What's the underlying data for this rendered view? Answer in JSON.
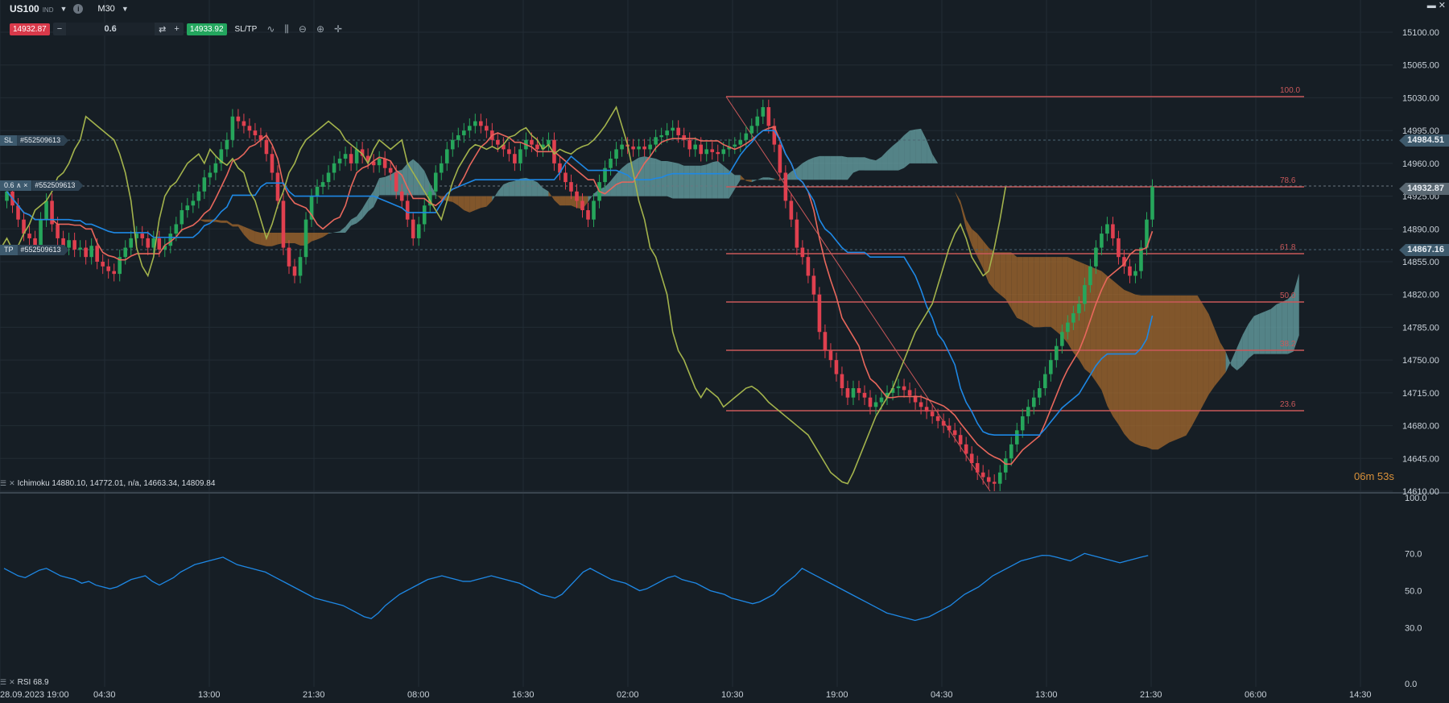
{
  "header": {
    "symbol": "US100",
    "symbol_suffix": "IND",
    "timeframe": "M30",
    "sell_price": "14932.87",
    "quantity": "0.6",
    "buy_price": "14933.92",
    "sltp_label": "SL/TP",
    "minus": "−",
    "plus": "+"
  },
  "tools": [
    "line-chart-icon",
    "candles-icon",
    "zoom-out-icon",
    "zoom-in-icon",
    "crosshair-icon"
  ],
  "right_axis": {
    "ticks": [
      "15100.00",
      "15065.00",
      "15030.00",
      "14995.00",
      "14960.00",
      "14925.00",
      "14890.00",
      "14855.00",
      "14820.00",
      "14785.00",
      "14750.00",
      "14715.00",
      "14680.00",
      "14645.00",
      "14610.00"
    ]
  },
  "rsi_axis": {
    "ticks": [
      "100.0",
      "70.0",
      "50.0",
      "30.0",
      "0.0"
    ]
  },
  "time_axis": [
    "28.09.2023 19:00",
    "04:30",
    "13:00",
    "21:30",
    "08:00",
    "16:30",
    "02:00",
    "10:30",
    "19:00",
    "04:30",
    "13:00",
    "21:30",
    "06:00",
    "14:30"
  ],
  "price_tags": {
    "sl": "14984.51",
    "current": "14932.87",
    "tp": "14867.16"
  },
  "orders": {
    "sl": {
      "label": "SL",
      "id": "#552509613"
    },
    "pos": {
      "label": "0.6 ∧ ×",
      "id": "#552509613"
    },
    "tp": {
      "label": "TP",
      "id": "#552509613"
    }
  },
  "fib_labels": [
    "100.0",
    "78.6",
    "61.8",
    "50.0",
    "38.2",
    "23.6"
  ],
  "indicators": {
    "ichimoku": "Ichimoku 14880.10, 14772.01, n/a, 14663.34, 14809.84",
    "rsi": "RSI 68.9"
  },
  "timer": "06m 53s",
  "colors": {
    "bg": "#161e25",
    "bull": "#26a65b",
    "bear": "#e0404f",
    "tenkan": "#e8675c",
    "kijun": "#1e88e5",
    "chikou": "#a3b34c",
    "kumo_bull": "#6aa5a8",
    "kumo_bear": "#a56a2e",
    "rsi": "#1e88e5",
    "fib": "#c9585a"
  },
  "chart_data": {
    "type": "line",
    "title": "US100 M30",
    "ylim": [
      14610,
      15100
    ],
    "close": [
      14930,
      14915,
      14900,
      14885,
      14880,
      14870,
      14900,
      14920,
      14895,
      14880,
      14870,
      14878,
      14868,
      14870,
      14860,
      14872,
      14855,
      14850,
      14845,
      14842,
      14860,
      14870,
      14880,
      14885,
      14880,
      14870,
      14880,
      14868,
      14872,
      14885,
      14895,
      14910,
      14915,
      14920,
      14930,
      14945,
      14950,
      14960,
      14975,
      14985,
      15010,
      15005,
      15000,
      14995,
      14990,
      14985,
      14970,
      14950,
      14920,
      14870,
      14850,
      14840,
      14860,
      14900,
      14925,
      14935,
      14940,
      14950,
      14960,
      14965,
      14970,
      14960,
      14975,
      14968,
      14962,
      14958,
      14965,
      14955,
      14950,
      14930,
      14920,
      14900,
      14880,
      14895,
      14915,
      14930,
      14950,
      14960,
      14975,
      14985,
      14990,
      14995,
      15000,
      15005,
      15000,
      14995,
      14985,
      14980,
      14975,
      14970,
      14960,
      14975,
      14985,
      14980,
      14975,
      14980,
      14985,
      14960,
      14950,
      14940,
      14930,
      14920,
      14910,
      14900,
      14920,
      14940,
      14955,
      14965,
      14975,
      14980,
      14978,
      14975,
      14978,
      14975,
      14980,
      14988,
      14990,
      14995,
      14998,
      14990,
      14985,
      14975,
      14980,
      14970,
      14975,
      14972,
      14970,
      14975,
      14978,
      14980,
      14985,
      14992,
      15000,
      15010,
      15020,
      15000,
      14980,
      14950,
      14920,
      14900,
      14870,
      14860,
      14840,
      14820,
      14780,
      14760,
      14750,
      14735,
      14720,
      14710,
      14720,
      14715,
      14710,
      14700,
      14705,
      14710,
      14715,
      14720,
      14722,
      14718,
      14712,
      14705,
      14700,
      14695,
      14690,
      14685,
      14680,
      14675,
      14670,
      14660,
      14650,
      14640,
      14630,
      14625,
      14620,
      14618,
      14630,
      14645,
      14660,
      14675,
      14690,
      14700,
      14710,
      14720,
      14735,
      14750,
      14765,
      14780,
      14790,
      14800,
      14810,
      14830,
      14850,
      14870,
      14885,
      14895,
      14880,
      14860,
      14850,
      14840,
      14845,
      14870,
      14900,
      14935
    ],
    "rsi": [
      62,
      60,
      58,
      57,
      59,
      61,
      62,
      60,
      58,
      57,
      56,
      54,
      55,
      53,
      52,
      51,
      52,
      54,
      56,
      57,
      58,
      55,
      53,
      55,
      57,
      60,
      62,
      64,
      65,
      66,
      67,
      68,
      66,
      64,
      63,
      62,
      61,
      60,
      58,
      56,
      54,
      52,
      50,
      48,
      46,
      45,
      44,
      43,
      42,
      40,
      38,
      36,
      35,
      38,
      42,
      45,
      48,
      50,
      52,
      54,
      56,
      57,
      58,
      57,
      56,
      55,
      55,
      56,
      57,
      58,
      57,
      56,
      55,
      54,
      52,
      50,
      48,
      47,
      46,
      48,
      52,
      56,
      60,
      62,
      60,
      58,
      56,
      55,
      54,
      52,
      50,
      51,
      53,
      55,
      57,
      58,
      56,
      55,
      54,
      52,
      50,
      49,
      48,
      46,
      45,
      44,
      43,
      44,
      46,
      48,
      52,
      55,
      58,
      62,
      60,
      58,
      56,
      54,
      52,
      50,
      48,
      46,
      44,
      42,
      40,
      38,
      37,
      36,
      35,
      34,
      35,
      36,
      38,
      40,
      42,
      45,
      48,
      50,
      52,
      55,
      58,
      60,
      62,
      64,
      66,
      67,
      68,
      69,
      68.9,
      68,
      67,
      66,
      68,
      70,
      69,
      68,
      67,
      66,
      65,
      66,
      67,
      68,
      68.9
    ]
  }
}
